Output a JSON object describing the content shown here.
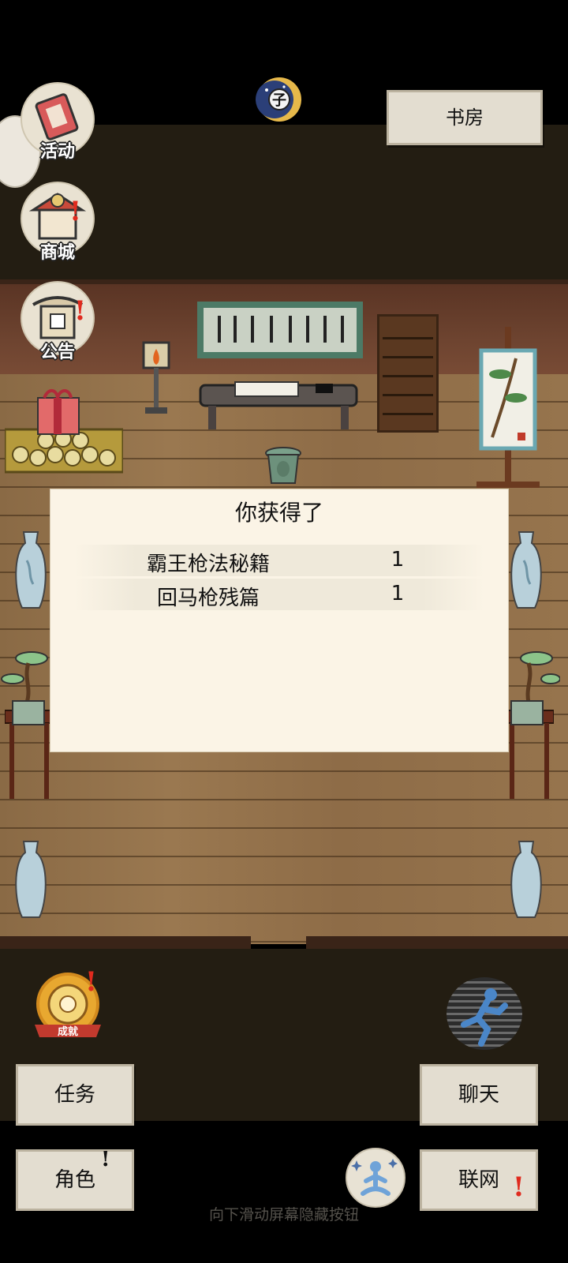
{
  "location_button": {
    "label": "书房"
  },
  "menu": {
    "activity": "活动",
    "shop": "商城",
    "notice": "公告"
  },
  "time_badge": {
    "symbol": "子"
  },
  "dialog": {
    "title": "你获得了",
    "items": [
      {
        "name": "霸王枪法秘籍",
        "qty": "1"
      },
      {
        "name": "回马枪残篇",
        "qty": "1"
      }
    ]
  },
  "achievement": {
    "label": "成就"
  },
  "bottom_buttons": {
    "task": "任务",
    "role": "角色",
    "chat": "聊天",
    "network": "联网"
  },
  "hint_text": "向下滑动屏幕隐藏按钮",
  "colors": {
    "paper": "#e3ddd0",
    "dialog_bg": "#fbf4e6",
    "alert_red": "#e02a1e",
    "floor": "#9a7850",
    "dark_band": "#231d12"
  }
}
